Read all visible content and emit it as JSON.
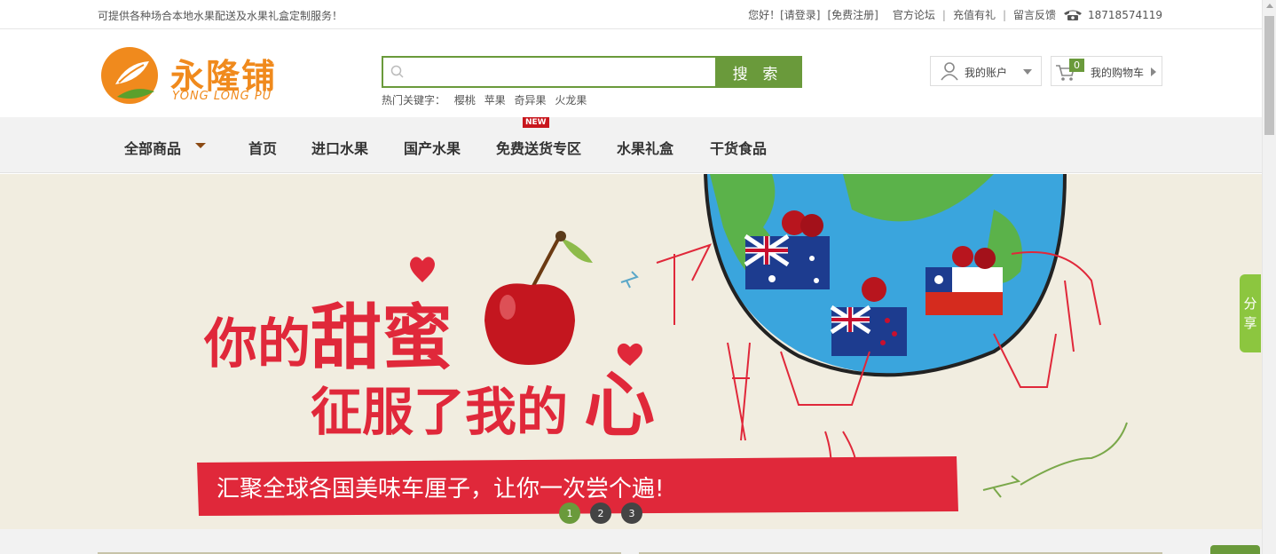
{
  "topbar": {
    "notice": "可提供各种场合本地水果配送及水果礼盒定制服务！",
    "greeting": "您好！",
    "login": "[请登录]",
    "register": "[免费注册]",
    "forum": "官方论坛",
    "recharge": "充值有礼",
    "feedback": "留言反馈",
    "phone": "18718574119"
  },
  "header": {
    "logo_cn": "永隆铺",
    "logo_en": "YONG LONG PU",
    "search_placeholder": "",
    "search_button": "搜 索",
    "hot_label": "热门关键字：",
    "hot_keywords": [
      "樱桃",
      "苹果",
      "奇异果",
      "火龙果"
    ],
    "account": "我的账户",
    "cart_label": "我的购物车",
    "cart_count": "0"
  },
  "nav": {
    "all": "全部商品",
    "items": [
      "首页",
      "进口水果",
      "国产水果",
      "免费送货专区",
      "水果礼盒",
      "干货食品"
    ],
    "new_badge": "NEW"
  },
  "banner": {
    "line1_a": "你的",
    "line1_b": "甜蜜",
    "line2_a": "征服了我的",
    "line2_b": "心",
    "tagline": "汇聚全球各国美味车厘子，让你一次尝个遍!",
    "slides": [
      "1",
      "2",
      "3"
    ],
    "active_slide": 1
  },
  "share": {
    "label_1": "分",
    "label_2": "享"
  },
  "colors": {
    "brand_green": "#6a9a3b",
    "logo_orange": "#f08a1d",
    "banner_red": "#e0283a"
  }
}
